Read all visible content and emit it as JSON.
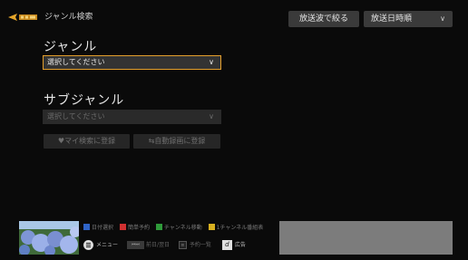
{
  "header": {
    "title": "ジャンル検索",
    "filter_button": "放送波で絞る",
    "sort_button": "放送日時順",
    "chevron_icon": "chevron-down-icon"
  },
  "genre": {
    "label": "ジャンル",
    "value": "選択してください",
    "focus_color": "#e49f2c"
  },
  "subgenre": {
    "label": "サブジャンル",
    "placeholder": "選択してください"
  },
  "actions": {
    "my_search": "♥マイ検索に登録",
    "auto_record": "⇆自動録画に登録"
  },
  "footer": {
    "legend": [
      {
        "label": "日付選択",
        "color": "#2f64c8"
      },
      {
        "label": "簡単予約",
        "color": "#d03030"
      },
      {
        "label": "チャンネル移動",
        "color": "#2f9a3a"
      },
      {
        "label": "1チャンネル番組表",
        "color": "#d8b020"
      }
    ],
    "menu": "メニュー",
    "skip": "前日/翌日",
    "reservations": "予約一覧",
    "d_key": "d",
    "d_label": "広告"
  }
}
